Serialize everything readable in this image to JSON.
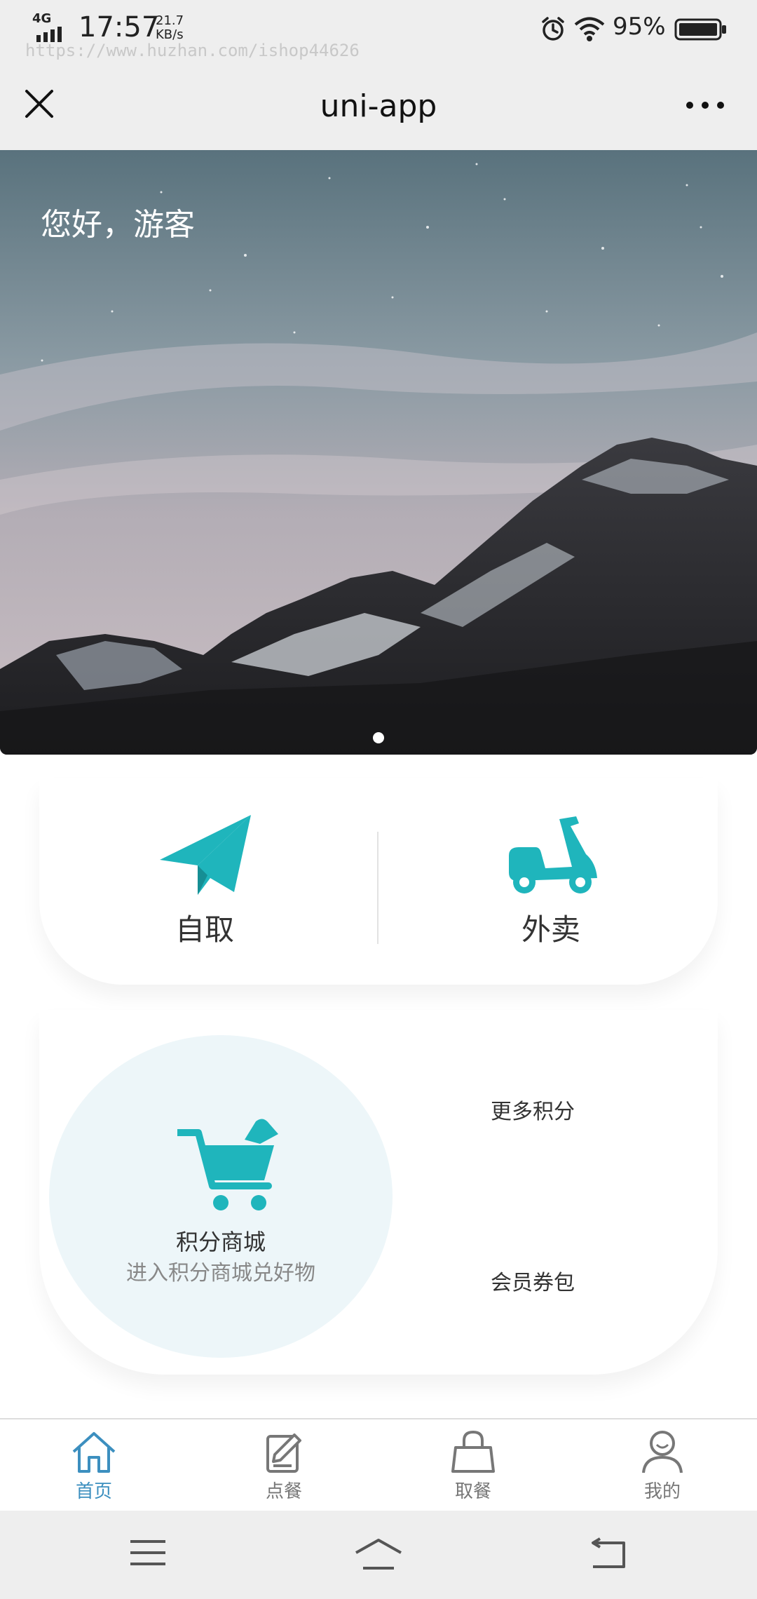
{
  "status_bar": {
    "network": "4G",
    "time": "17:57",
    "speed_value": "21.7",
    "speed_unit": "KB/s",
    "watermark_url": "https://www.huzhan.com/ishop44626",
    "battery": "95%",
    "icons": [
      "signal-icon",
      "alarm-icon",
      "wifi-icon",
      "battery-icon"
    ]
  },
  "nav": {
    "title": "uni-app",
    "close_icon": "close-icon",
    "more_icon": "more-icon"
  },
  "banner": {
    "greeting": "您好，游客",
    "page_count": 1,
    "active_page": 1
  },
  "order": {
    "pickup_label": "自取",
    "pickup_icon": "paper-plane-icon",
    "delivery_label": "外卖",
    "delivery_icon": "scooter-icon"
  },
  "points": {
    "mall_title": "积分商城",
    "mall_subtitle": "进入积分商城兑好物",
    "mall_icon": "cart-icon",
    "more_points": "更多积分",
    "member_coupons": "会员券包"
  },
  "tabs": [
    {
      "label": "首页",
      "icon": "home-icon",
      "active": true
    },
    {
      "label": "点餐",
      "icon": "edit-icon",
      "active": false
    },
    {
      "label": "取餐",
      "icon": "bag-icon",
      "active": false
    },
    {
      "label": "我的",
      "icon": "user-icon",
      "active": false
    }
  ],
  "system_nav": [
    "menu-icon",
    "home-button-icon",
    "back-icon"
  ],
  "colors": {
    "accent": "#1fb5bc",
    "tab_active": "#3c8fbf",
    "bar_bg": "#eeeeee",
    "circle_bg": "#edf6f9"
  }
}
